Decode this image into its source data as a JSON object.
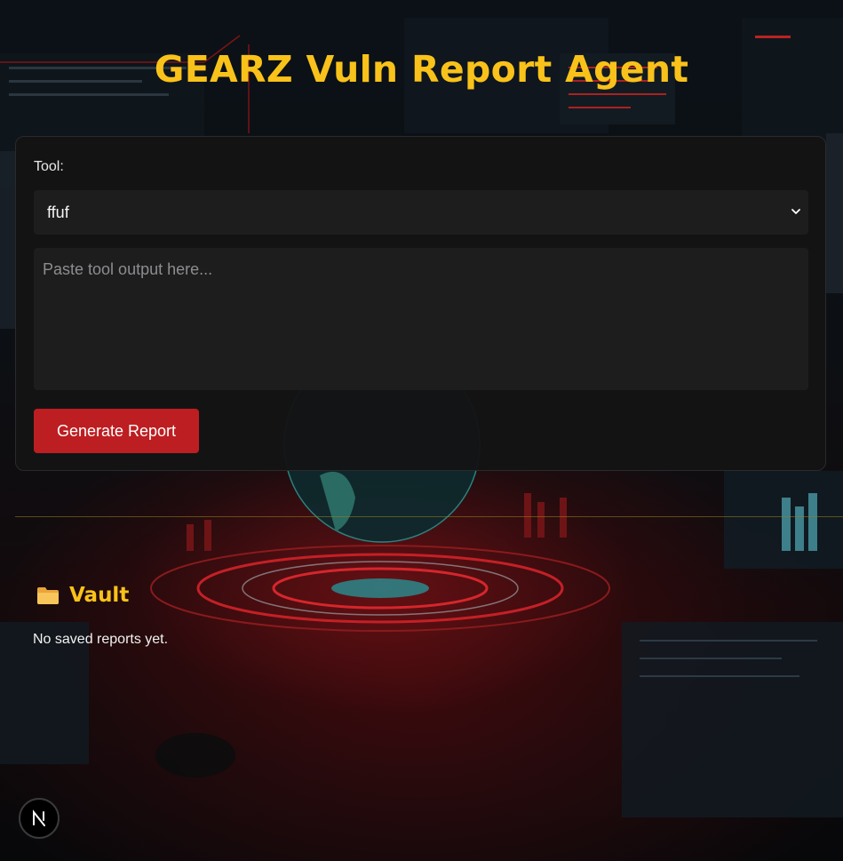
{
  "app": {
    "title": "GEARZ Vuln Report Agent"
  },
  "form": {
    "tool_label": "Tool:",
    "tool_selected": "ffuf",
    "output_placeholder": "Paste tool output here...",
    "output_value": "",
    "generate_label": "Generate Report"
  },
  "vault": {
    "icon": "folder-icon",
    "title": "Vault",
    "empty_message": "No saved reports yet."
  },
  "badge": {
    "icon": "nextjs-logo-icon",
    "letter": "N"
  },
  "colors": {
    "accent": "#f9c21a",
    "primary_button": "#bd1e21",
    "panel": "#141415",
    "background": "#07090c"
  }
}
